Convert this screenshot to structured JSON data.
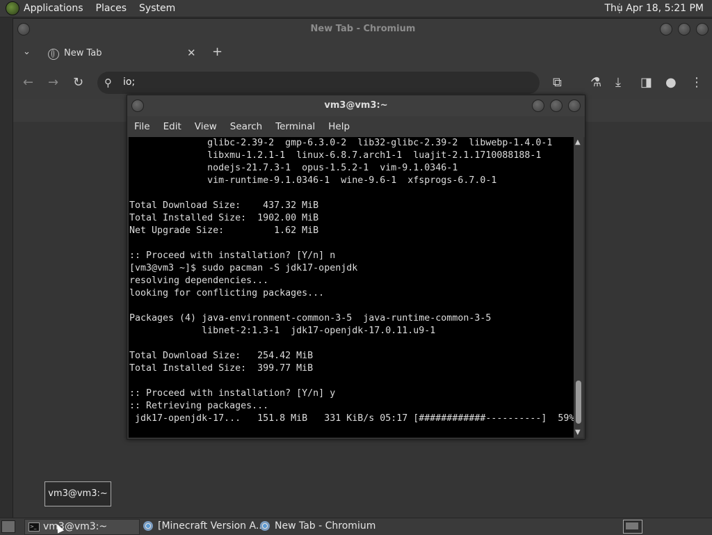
{
  "top_panel": {
    "menus": [
      "Applications",
      "Places",
      "System"
    ],
    "clock": "Thu Apr 18,  5:21 PM"
  },
  "chromium": {
    "window_title": "New Tab - Chromium",
    "tab_title": "New Tab",
    "omnibox_value": "io;",
    "icons": [
      "back-icon",
      "forward-icon",
      "reload-icon",
      "search-icon",
      "extensions-icon",
      "labs-icon",
      "download-icon",
      "side-panel-icon",
      "profile-icon",
      "menu-icon"
    ]
  },
  "terminal": {
    "window_title": "vm3@vm3:~",
    "menus": [
      "File",
      "Edit",
      "View",
      "Search",
      "Terminal",
      "Help"
    ],
    "lines": [
      "              glibc-2.39-2  gmp-6.3.0-2  lib32-glibc-2.39-2  libwebp-1.4.0-1",
      "              libxmu-1.2.1-1  linux-6.8.7.arch1-1  luajit-2.1.1710088188-1",
      "              nodejs-21.7.3-1  opus-1.5.2-1  vim-9.1.0346-1",
      "              vim-runtime-9.1.0346-1  wine-9.6-1  xfsprogs-6.7.0-1",
      "",
      "Total Download Size:    437.32 MiB",
      "Total Installed Size:  1902.00 MiB",
      "Net Upgrade Size:         1.62 MiB",
      "",
      ":: Proceed with installation? [Y/n] n",
      "[vm3@vm3 ~]$ sudo pacman -S jdk17-openjdk",
      "resolving dependencies...",
      "looking for conflicting packages...",
      "",
      "Packages (4) java-environment-common-3-5  java-runtime-common-3-5",
      "             libnet-2:1.3-1  jdk17-openjdk-17.0.11.u9-1",
      "",
      "Total Download Size:   254.42 MiB",
      "Total Installed Size:  399.77 MiB",
      "",
      ":: Proceed with installation? [Y/n] y",
      ":: Retrieving packages...",
      " jdk17-openjdk-17...   151.8 MiB   331 KiB/s 05:17 [############----------]  59%"
    ],
    "download_progress_percent": 59
  },
  "tooltip": "vm3@vm3:~",
  "taskbar": {
    "tasks": [
      {
        "label": "vm3@vm3:~",
        "icon": "terminal-icon",
        "active": true
      },
      {
        "label": "[Minecraft Version A...",
        "icon": "chromium-icon",
        "active": false
      },
      {
        "label": "New Tab - Chromium",
        "icon": "chromium-icon",
        "active": false
      }
    ]
  }
}
